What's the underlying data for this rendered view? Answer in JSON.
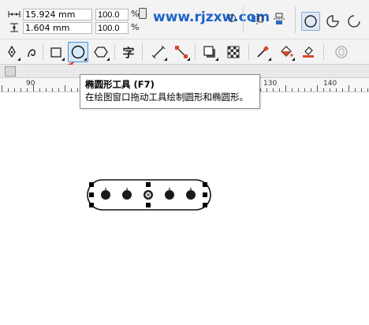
{
  "property_bar": {
    "width_value": "15.924 mm",
    "height_value": "1.604 mm",
    "scale_x": "100.0",
    "scale_y": "100.0",
    "percent_unit": "%",
    "watermark": "www.rjzxw.com",
    "icons": [
      "width-icon",
      "height-icon",
      "lock-ratio-icon",
      "circle-preview-icon",
      "mirror-horizontal-icon",
      "mirror-vertical-icon",
      "ellipse-mode-icon",
      "pie-mode-icon",
      "arc-mode-icon"
    ]
  },
  "toolbox": {
    "tools": [
      {
        "name": "freehand-tool",
        "icon": "pen-nib-icon"
      },
      {
        "name": "artistic-media-tool",
        "icon": "curve-icon"
      },
      {
        "name": "rectangle-tool",
        "icon": "rectangle-icon"
      },
      {
        "name": "ellipse-tool",
        "icon": "ellipse-icon",
        "active": true
      },
      {
        "name": "polygon-tool",
        "icon": "polygon-icon"
      },
      {
        "name": "text-tool",
        "icon": "text-icon",
        "glyph": "字"
      },
      {
        "name": "parallel-dimension-tool",
        "icon": "dimension-line-icon"
      },
      {
        "name": "connector-tool",
        "icon": "connector-icon"
      },
      {
        "name": "drop-shadow-tool",
        "icon": "drop-shadow-icon"
      },
      {
        "name": "transparency-tool",
        "icon": "checkerboard-icon"
      },
      {
        "name": "eyedropper-tool",
        "icon": "eyedropper-icon"
      },
      {
        "name": "interactive-fill-tool",
        "icon": "paint-bucket-icon"
      },
      {
        "name": "smart-fill-tool",
        "icon": "smart-fill-icon"
      },
      {
        "name": "lens-tool",
        "icon": "lens-icon"
      }
    ],
    "accent_color": "#4a8fd4",
    "arrow_color": "#e8312a"
  },
  "ruler": {
    "labels": [
      "90",
      "130",
      "140"
    ]
  },
  "tooltip": {
    "title": "椭圆形工具 (F7)",
    "description": "在绘图窗口拖动工具绘制圆形和椭圆形。"
  },
  "canvas": {
    "selected_object": "rounded-rectangle-with-five-dots",
    "selection_mark": "✕"
  }
}
